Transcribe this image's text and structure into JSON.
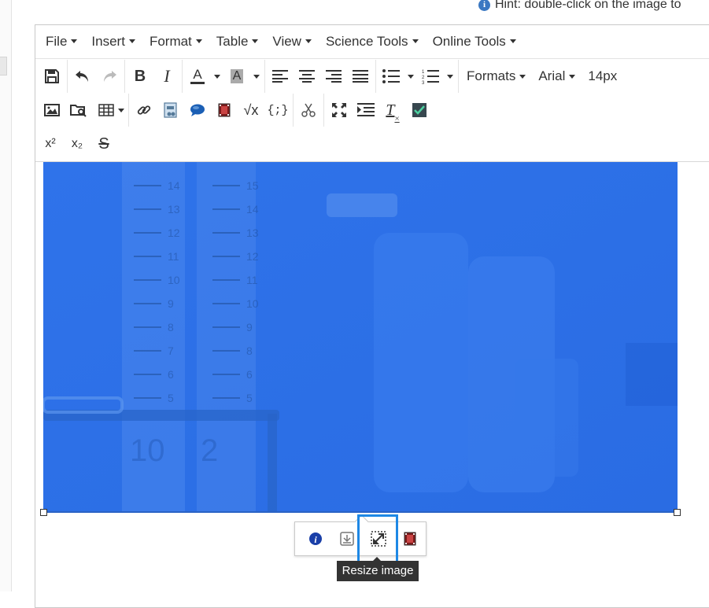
{
  "hint": {
    "icon": "info-icon",
    "text": "Hint: double-click on the image to"
  },
  "menubar": {
    "items": [
      {
        "label": "File"
      },
      {
        "label": "Insert"
      },
      {
        "label": "Format"
      },
      {
        "label": "Table"
      },
      {
        "label": "View"
      },
      {
        "label": "Science Tools"
      },
      {
        "label": "Online Tools"
      }
    ]
  },
  "toolbar": {
    "bold_label": "B",
    "italic_label": "I",
    "text_color_label": "A",
    "bg_color_label": "A",
    "formats_label": "Formats",
    "font_label": "Arial",
    "font_size_label": "14px",
    "equation_label": "√x",
    "code_label": "{;}",
    "superscript_label": "x²",
    "subscript_label": "x₂",
    "strikethrough_label": "S",
    "clear_format_label": "T"
  },
  "image": {
    "description_icon": "lab-glassware-photo",
    "tint_color": "#2b70e8"
  },
  "image_toolbar": {
    "buttons": [
      {
        "icon": "info-icon"
      },
      {
        "icon": "download-icon"
      },
      {
        "icon": "resize-icon"
      },
      {
        "icon": "film-icon"
      }
    ],
    "tooltip": "Resize image"
  },
  "colors": {
    "accent": "#1e88e5",
    "image_blue": "#2b70e8"
  }
}
